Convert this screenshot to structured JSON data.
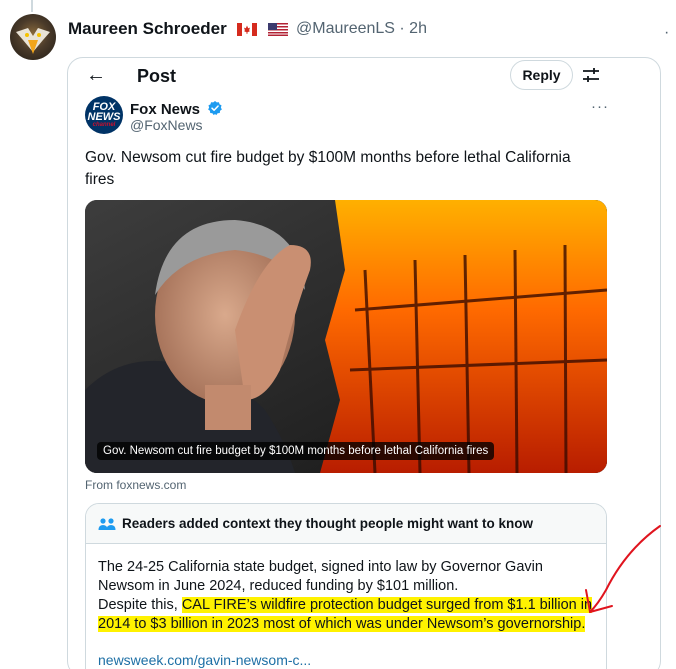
{
  "outer_post": {
    "name": "Maureen Schroeder",
    "handle_time": "@MaureenLS · 2h",
    "more_label": "·"
  },
  "quoted_post": {
    "header_title": "Post",
    "reply_label": "Reply",
    "author": {
      "name": "Fox News",
      "handle": "@FoxNews",
      "logo_top": "FOX",
      "logo_mid": "NEWS",
      "logo_bottom": "channel"
    },
    "more_label": "···",
    "text": "Gov. Newsom cut fire budget by $100M months before lethal California fires",
    "media_caption": "Gov. Newsom cut fire budget by $100M months before lethal California fires",
    "source": "From foxnews.com"
  },
  "community_note": {
    "title": "Readers added context they thought people might want to know",
    "body_plain": "The 24-25 California state budget, signed into law by Governor Gavin Newsom in June 2024, reduced funding by $101 million.",
    "body_lead": "Despite this, ",
    "body_highlight": "CAL FIRE’s wildfire protection budget surged from $1.1 billion in 2014 to $3 billion in 2023 most of which was under Newsom’s governorship.",
    "link": "newsweek.com/gavin-newsom-c..."
  },
  "colors": {
    "accent_blue": "#1d9bf0",
    "link_blue": "#1d6fa5",
    "highlight": "#fff200",
    "annotation_red": "#e0141e",
    "fox_navy": "#003366"
  }
}
